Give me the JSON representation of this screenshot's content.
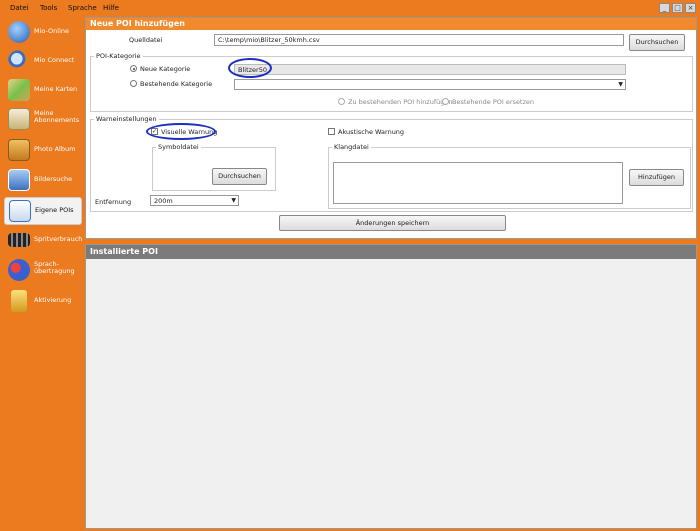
{
  "menu": [
    "Datei",
    "Tools",
    "Sprache",
    "Hilfe"
  ],
  "sidebar": [
    {
      "label": "Mio-Online",
      "icon": "globe-icon",
      "color": "#3a6fc4"
    },
    {
      "label": "Mio Connect",
      "icon": "magnifier-icon",
      "color": "#4a7bd0"
    },
    {
      "label": "Meine Karten",
      "icon": "map-icon",
      "color": "#5aa832"
    },
    {
      "label": "Meine Abonnements",
      "icon": "letter-icon",
      "color": "#c9b57a"
    },
    {
      "label": "Photo Album",
      "icon": "photo-album-icon",
      "color": "#d89a3a"
    },
    {
      "label": "Bildersuche",
      "icon": "image-search-icon",
      "color": "#5a8fd2"
    },
    {
      "label": "Eigene POIs",
      "icon": "poi-icon",
      "color": "#3b72c9"
    },
    {
      "label": "Spritverbrauch",
      "icon": "fuel-gauge-icon",
      "color": "#444444"
    },
    {
      "label": "Sprach-übertragung",
      "icon": "speech-icon",
      "color": "#3a5fd0"
    },
    {
      "label": "Aktivierung",
      "icon": "padlock-icon",
      "color": "#e0b030"
    }
  ],
  "neue_poi": {
    "title": "Neue POI hinzufügen",
    "quelldatei_label": "Quelldatei",
    "quelldatei_value": "C:\\temp\\mio\\Blitzer_50kmh.csv",
    "browse_label": "Durchsuchen",
    "kategorie_group": "POI-Kategorie",
    "neue_kategorie_label": "Neue Kategorie",
    "neue_kategorie_value": "Blitzer50",
    "bestehende_kategorie_label": "Bestehende Kategorie",
    "zu_bestehenden_label": "Zu bestehenden POI hinzufügen",
    "ersetzen_label": "Bestehende POI ersetzen",
    "warn_group": "Warneinstellungen",
    "visuelle_label": "Visuelle Warnung",
    "akustische_label": "Akustische Warnung",
    "symboldatei_label": "Symboldatei",
    "symbol_browse_label": "Durchsuchen",
    "klangdatei_label": "Klangdatei",
    "hinzufuegen_label": "Hinzufügen",
    "entfernung_label": "Entfernung",
    "entfernung_value": "200m",
    "save_label": "Änderungen speichern"
  },
  "installierte": {
    "title": "Installierte POI"
  },
  "colors": {
    "orange": "#ec7a1e",
    "title_orange": "#f08a2c",
    "title_gray": "#7b7b7b",
    "ellipse": "#1b2fbf"
  }
}
